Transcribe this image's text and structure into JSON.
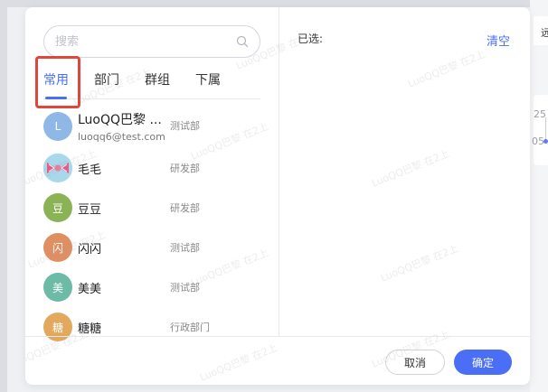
{
  "search": {
    "placeholder": "搜索"
  },
  "tabs": [
    {
      "label": "常用",
      "active": true
    },
    {
      "label": "部门",
      "active": false
    },
    {
      "label": "群组",
      "active": false
    },
    {
      "label": "下属",
      "active": false
    }
  ],
  "contacts": [
    {
      "name": "LuoQQ巴黎 ...",
      "email": "luoqq6@test.com",
      "dept": "测试部",
      "avatar": "L",
      "color": "#8fb8e6"
    },
    {
      "name": "毛毛",
      "dept": "研发部",
      "avatar": "",
      "color": "#f0a0b8"
    },
    {
      "name": "豆豆",
      "dept": "研发部",
      "avatar": "豆",
      "color": "#8ab356"
    },
    {
      "name": "闪闪",
      "dept": "测试部",
      "avatar": "闪",
      "color": "#e08f63"
    },
    {
      "name": "美美",
      "dept": "测试部",
      "avatar": "美",
      "color": "#6dbaa7"
    },
    {
      "name": "糖糖",
      "dept": "行政部门",
      "avatar": "糖",
      "color": "#e2a85e"
    }
  ],
  "selected": {
    "label": "已选:",
    "clear": "清空"
  },
  "footer": {
    "cancel": "取消",
    "ok": "确定"
  },
  "watermark": "LuoQQ巴黎 在2上",
  "background": {
    "right_texts": [
      "远",
      "25",
      "05"
    ]
  },
  "colors": {
    "accent": "#4a6ef5",
    "highlight": "#e0463a"
  }
}
